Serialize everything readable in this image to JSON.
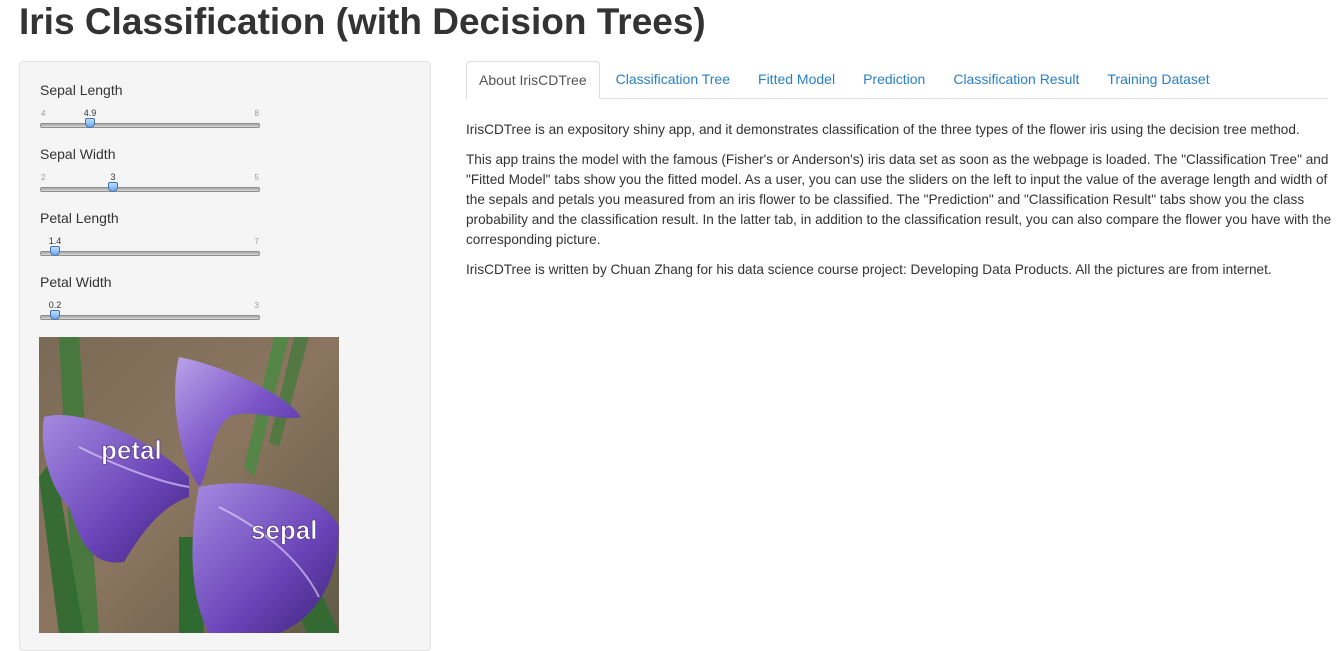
{
  "page": {
    "title": "Iris Classification (with Decision Trees)"
  },
  "sidebar": {
    "sliders": [
      {
        "label": "Sepal Length",
        "min": "4",
        "max": "8",
        "value": "4.9",
        "fraction": 0.225
      },
      {
        "label": "Sepal Width",
        "min": "2",
        "max": "5",
        "value": "3",
        "fraction": 0.333
      },
      {
        "label": "Petal Length",
        "min": "1",
        "max": "7",
        "value": "1.4",
        "fraction": 0.067
      },
      {
        "label": "Petal Width",
        "min": "0",
        "max": "3",
        "value": "0.2",
        "fraction": 0.067
      }
    ],
    "image": {
      "label_petal": "petal",
      "label_sepal": "sepal"
    }
  },
  "tabs": [
    {
      "label": "About IrisCDTree",
      "active": true
    },
    {
      "label": "Classification Tree",
      "active": false
    },
    {
      "label": "Fitted Model",
      "active": false
    },
    {
      "label": "Prediction",
      "active": false
    },
    {
      "label": "Classification Result",
      "active": false
    },
    {
      "label": "Training Dataset",
      "active": false
    }
  ],
  "about": {
    "paragraphs": [
      "IrisCDTree is an expository shiny app, and it demonstrates classification of the three types of the flower iris using the decision tree method.",
      "This app trains the model with the famous (Fisher's or Anderson's) iris data set as soon as the webpage is loaded. The \"Classification Tree\" and \"Fitted Model\" tabs show you the fitted model. As a user, you can use the sliders on the left to input the value of the average length and width of the sepals and petals you measured from an iris flower to be classified. The \"Prediction\" and \"Classification Result\" tabs show you the class probability and the classification result. In the latter tab, in addition to the classification result, you can also compare the flower you have with the corresponding picture.",
      "IrisCDTree is written by Chuan Zhang for his data science course project: Developing Data Products. All the pictures are from internet."
    ]
  },
  "colors": {
    "link": "#2a7fc9",
    "well_bg": "#f5f5f5",
    "handle": "#6ea7e8"
  }
}
